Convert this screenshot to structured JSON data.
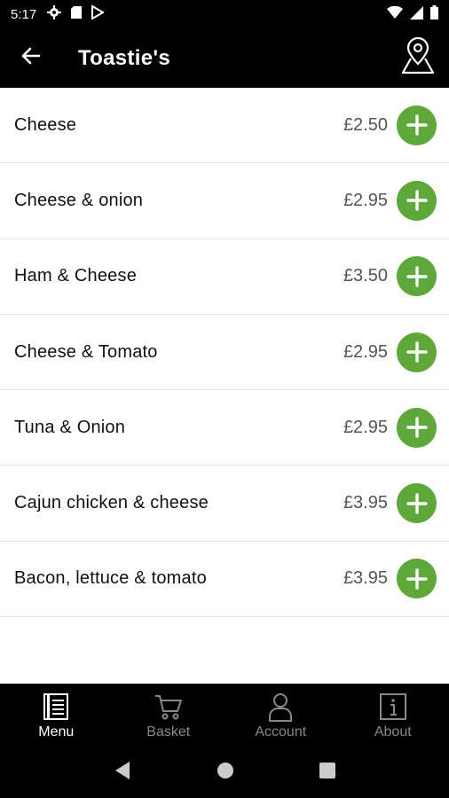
{
  "status_bar": {
    "time": "5:17",
    "left_icons": [
      "settings-icon",
      "sd-card-icon",
      "play-store-icon"
    ],
    "right_icons": [
      "wifi-icon",
      "cell-signal-icon",
      "battery-icon"
    ]
  },
  "app_bar": {
    "title": "Toastie's",
    "back_icon": "arrow-left-icon",
    "location_icon": "map-location-icon"
  },
  "menu_items": [
    {
      "name": "Cheese",
      "price": "£2.50"
    },
    {
      "name": "Cheese & onion",
      "price": "£2.95"
    },
    {
      "name": "Ham & Cheese",
      "price": "£3.50"
    },
    {
      "name": "Cheese & Tomato",
      "price": "£2.95"
    },
    {
      "name": "Tuna & Onion",
      "price": "£2.95"
    },
    {
      "name": "Cajun chicken & cheese",
      "price": "£3.95"
    },
    {
      "name": "Bacon, lettuce & tomato",
      "price": "£3.95"
    }
  ],
  "colors": {
    "accent_green": "#5ea83a",
    "bar_bg": "#000000",
    "nav_inactive": "#888888",
    "nav_active": "#ffffff"
  },
  "bottom_nav": {
    "items": [
      {
        "label": "Menu",
        "icon": "menu-book-icon",
        "active": true
      },
      {
        "label": "Basket",
        "icon": "cart-icon",
        "active": false
      },
      {
        "label": "Account",
        "icon": "person-icon",
        "active": false
      },
      {
        "label": "About",
        "icon": "info-icon",
        "active": false
      }
    ]
  },
  "system_nav": [
    "back-triangle-icon",
    "home-circle-icon",
    "recents-square-icon"
  ]
}
